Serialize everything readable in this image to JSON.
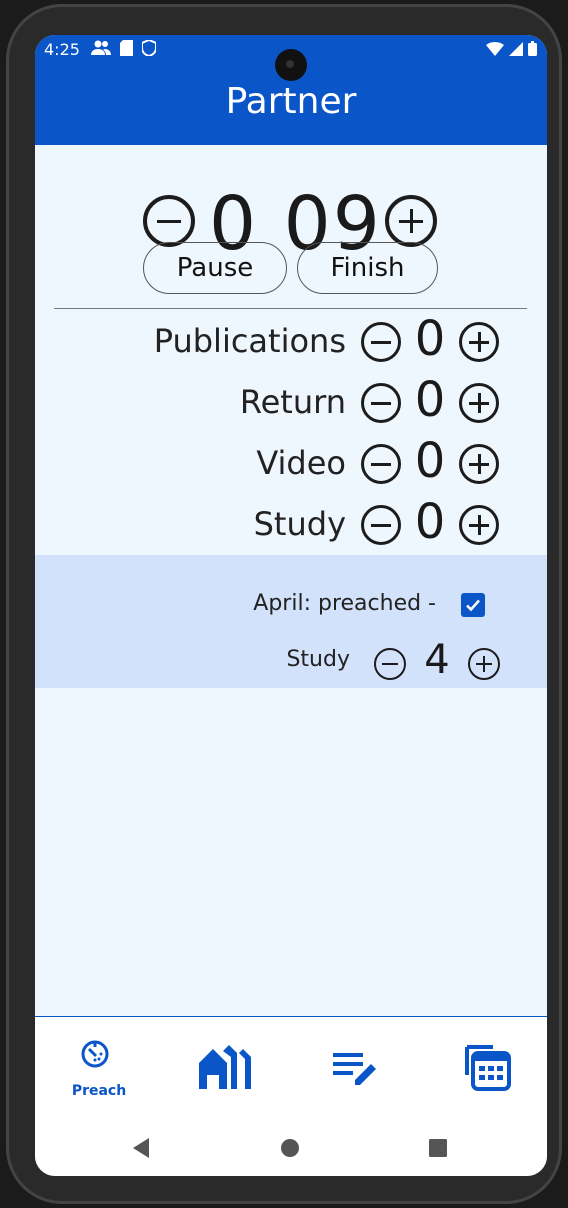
{
  "status_bar": {
    "time": "4:25"
  },
  "app_bar": {
    "title": "Partner"
  },
  "timer": {
    "hours": "0",
    "minutes": "09"
  },
  "buttons": {
    "pause": "Pause",
    "finish": "Finish"
  },
  "counters": [
    {
      "label": "Publications",
      "value": "0"
    },
    {
      "label": "Return",
      "value": "0"
    },
    {
      "label": "Video",
      "value": "0"
    },
    {
      "label": "Study",
      "value": "0"
    }
  ],
  "month_panel": {
    "month_text": "April: preached -",
    "checked": true,
    "study_label": "Study",
    "study_value": "4"
  },
  "bottom_nav": {
    "items": [
      {
        "icon": "timer-icon",
        "label": "Preach",
        "selected": true
      },
      {
        "icon": "houses-icon",
        "label": "",
        "selected": false
      },
      {
        "icon": "edit-list-icon",
        "label": "",
        "selected": false
      },
      {
        "icon": "calendar-icon",
        "label": "",
        "selected": false
      }
    ]
  },
  "colors": {
    "primary": "#0a55c8",
    "background": "#eef6fe",
    "panel": "#d2e2fa"
  }
}
